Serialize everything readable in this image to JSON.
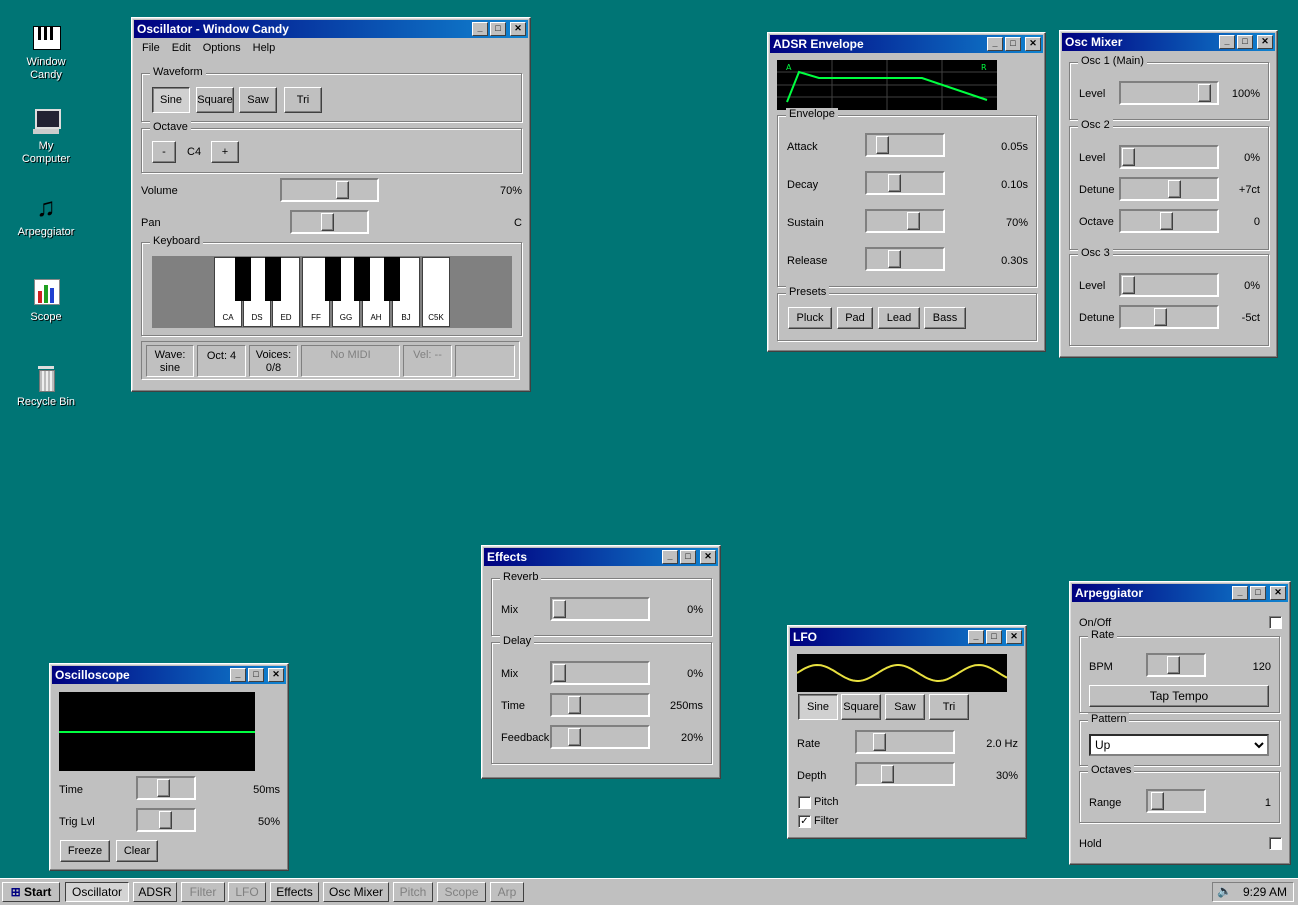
{
  "desktop": {
    "icons": [
      {
        "label1": "Window",
        "label2": "Candy"
      },
      {
        "label1": "My",
        "label2": "Computer"
      },
      {
        "label1": "Arpeggiator",
        "label2": ""
      },
      {
        "label1": "Scope",
        "label2": ""
      },
      {
        "label1": "Recycle Bin",
        "label2": ""
      }
    ]
  },
  "osc": {
    "title": "Oscillator - Window Candy",
    "menu": [
      "File",
      "Edit",
      "Options",
      "Help"
    ],
    "waveform_label": "Waveform",
    "waves": [
      "Sine",
      "Square",
      "Saw",
      "Tri"
    ],
    "octave_label": "Octave",
    "oct_minus": "-",
    "oct_value": "C4",
    "oct_plus": "+",
    "volume_label": "Volume",
    "volume_value": "70%",
    "volume_level": 0.7,
    "pan_label": "Pan",
    "pan_value": "C",
    "pan_level": 0.5,
    "keyboard_label": "Keyboard",
    "keys": [
      "CA",
      "DS",
      "ED",
      "FF",
      "GG",
      "AH",
      "BJ",
      "C5K"
    ],
    "status": {
      "wave1": "Wave:",
      "wave2": "sine",
      "oct": "Oct: 4",
      "voices1": "Voices:",
      "voices2": "0/8",
      "midi": "No MIDI",
      "vel": "Vel: --"
    }
  },
  "adsr": {
    "title": "ADSR Envelope",
    "marker_a": "A",
    "marker_r": "R",
    "envelope_label": "Envelope",
    "rows": [
      {
        "label": "Attack",
        "value": "0.05s",
        "level": 0.15
      },
      {
        "label": "Decay",
        "value": "0.10s",
        "level": 0.35
      },
      {
        "label": "Sustain",
        "value": "70%",
        "level": 0.7
      },
      {
        "label": "Release",
        "value": "0.30s",
        "level": 0.35
      }
    ],
    "presets_label": "Presets",
    "presets": [
      "Pluck",
      "Pad",
      "Lead",
      "Bass"
    ]
  },
  "mixer": {
    "title": "Osc Mixer",
    "osc1_label": "Osc 1 (Main)",
    "osc1_level_label": "Level",
    "osc1_level_value": "100%",
    "osc1_level": 1.0,
    "osc2_label": "Osc 2",
    "osc2_level_label": "Level",
    "osc2_level_value": "0%",
    "osc2_level": 0.0,
    "osc2_detune_label": "Detune",
    "osc2_detune_value": "+7ct",
    "osc2_detune": 0.6,
    "osc2_octave_label": "Octave",
    "osc2_octave_value": "0",
    "osc2_octave": 0.5,
    "osc3_label": "Osc 3",
    "osc3_level_label": "Level",
    "osc3_level_value": "0%",
    "osc3_level": 0.0,
    "osc3_detune_label": "Detune",
    "osc3_detune_value": "-5ct",
    "osc3_detune": 0.42
  },
  "effects": {
    "title": "Effects",
    "reverb_label": "Reverb",
    "reverb_mix_label": "Mix",
    "reverb_mix_value": "0%",
    "reverb_mix": 0.0,
    "delay_label": "Delay",
    "delay_mix_label": "Mix",
    "delay_mix_value": "0%",
    "delay_mix": 0.0,
    "delay_time_label": "Time",
    "delay_time_value": "250ms",
    "delay_time": 0.2,
    "delay_fb_label": "Feedback",
    "delay_fb_value": "20%",
    "delay_fb": 0.2
  },
  "scope": {
    "title": "Oscilloscope",
    "time_label": "Time",
    "time_value": "50ms",
    "time_level": 0.5,
    "trig_label": "Trig Lvl",
    "trig_value": "50%",
    "trig_level": 0.55,
    "freeze": "Freeze",
    "clear": "Clear"
  },
  "lfo": {
    "title": "LFO",
    "waves": [
      "Sine",
      "Square",
      "Saw",
      "Tri"
    ],
    "rate_label": "Rate",
    "rate_value": "2.0 Hz",
    "rate_level": 0.2,
    "depth_label": "Depth",
    "depth_value": "30%",
    "depth_level": 0.3,
    "pitch_label": "Pitch",
    "pitch_checked": false,
    "filter_label": "Filter",
    "filter_checked": true
  },
  "arp": {
    "title": "Arpeggiator",
    "onoff_label": "On/Off",
    "rate_label": "Rate",
    "bpm_label": "BPM",
    "bpm_value": "120",
    "bpm_level": 0.5,
    "tap_tempo": "Tap Tempo",
    "pattern_label": "Pattern",
    "pattern_value": "Up",
    "octaves_label": "Octaves",
    "range_label": "Range",
    "range_value": "1",
    "range_level": 0.05,
    "hold_label": "Hold"
  },
  "taskbar": {
    "start": "Start",
    "items": [
      "Oscillator",
      "ADSR",
      "Filter",
      "LFO",
      "Effects",
      "Osc Mixer",
      "Pitch",
      "Scope",
      "Arp"
    ],
    "clock": "9:29 AM"
  },
  "colors": {
    "desktop": "#007575",
    "title_from": "#000080",
    "title_to": "#1084d0",
    "trace": "#00ff40",
    "lfo_trace": "#e8e040"
  }
}
